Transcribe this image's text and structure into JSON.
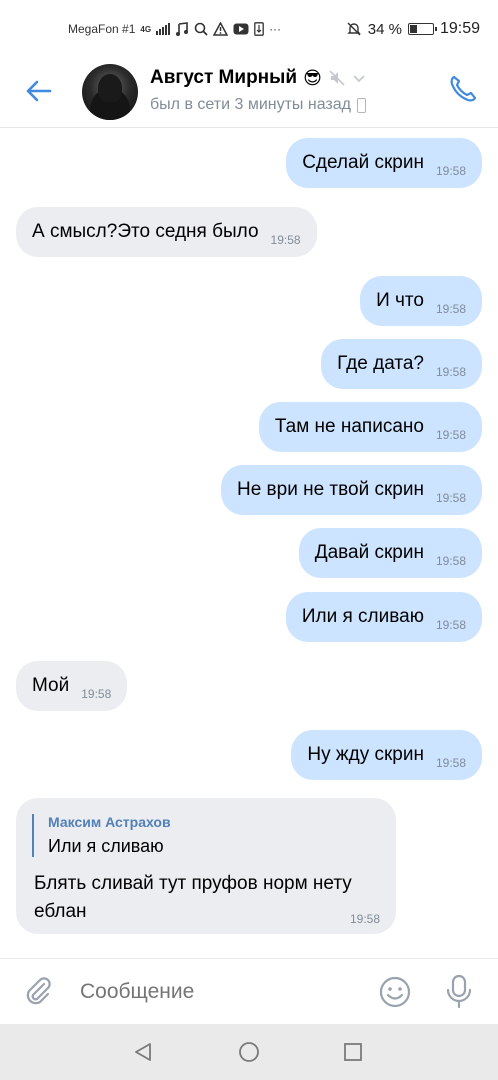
{
  "status_bar": {
    "carrier": "MegaFon #1",
    "network": "4G",
    "battery_text": "34 %",
    "battery_level": 0.34,
    "time": "19:59"
  },
  "header": {
    "name": "Август Мирный",
    "emoji": "😎",
    "last_seen": "был в сети 3 минуты назад"
  },
  "messages": [
    {
      "dir": "out",
      "text": "Сделай скрин",
      "time": "19:58"
    },
    {
      "dir": "in",
      "text": "А смысл?Это седня было",
      "time": "19:58"
    },
    {
      "dir": "out",
      "text": "И что",
      "time": "19:58"
    },
    {
      "dir": "out",
      "text": "Где дата?",
      "time": "19:58"
    },
    {
      "dir": "out",
      "text": "Там не написано",
      "time": "19:58"
    },
    {
      "dir": "out",
      "text": "Не ври не твой скрин",
      "time": "19:58"
    },
    {
      "dir": "out",
      "text": "Давай скрин",
      "time": "19:58"
    },
    {
      "dir": "out",
      "text": "Или я сливаю",
      "time": "19:58"
    },
    {
      "dir": "in",
      "text": "Мой",
      "time": "19:58"
    },
    {
      "dir": "out",
      "text": "Ну жду скрин",
      "time": "19:58"
    }
  ],
  "reply_message": {
    "quote_author": "Максим Астрахов",
    "quote_text": "Или я сливаю",
    "text": "Блять сливай тут пруфов норм нету еблан",
    "time": "19:58"
  },
  "composer": {
    "placeholder": "Сообщение"
  },
  "colors": {
    "accent": "#3f8ae0",
    "outgoing_bubble": "#cce4ff",
    "incoming_bubble": "#ebedf0",
    "secondary_text": "#818c99"
  }
}
